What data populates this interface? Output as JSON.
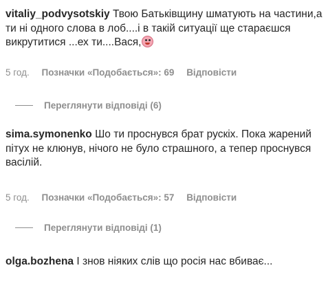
{
  "comments": [
    {
      "username": "vitaliy_podvysotskiy",
      "text": "Твою Батьківщину шматують на частини,а ти ні одного слова в лоб....і в такій ситуації ще стараєшся викрутитися ...ех ти....Вася,",
      "emoji": "clown-face-icon",
      "time": "5 год.",
      "likes": "Позначки «Подобається»: 69",
      "reply": "Відповісти",
      "view_replies": "Переглянути відповіді (6)"
    },
    {
      "username": "sima.symonenko",
      "text": "Шо ти проснувся брат рускіх. Пока жарений пітух не клюнув, нічого не було страшного, а тепер проснувся васілій.",
      "time": "5 год.",
      "likes": "Позначки «Подобається»: 57",
      "reply": "Відповісти",
      "view_replies": "Переглянути відповіді (1)"
    },
    {
      "username": "olga.bozhena",
      "text": "І знов ніяких слів що росія нас вбиває..."
    }
  ]
}
